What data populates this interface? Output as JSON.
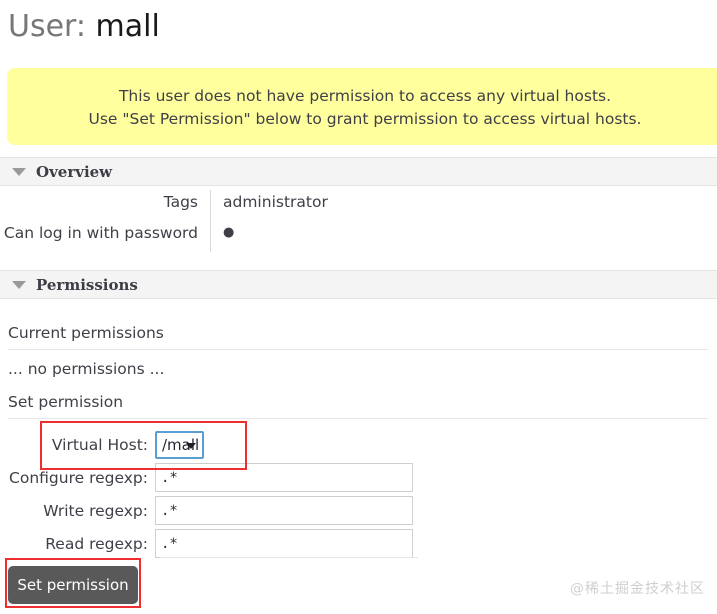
{
  "page": {
    "title_prefix": "User:",
    "title_value": "mall"
  },
  "warning": {
    "line1": "This user does not have permission to access any virtual hosts.",
    "line2": "Use \"Set Permission\" below to grant permission to access virtual hosts.",
    "background_color": "#ffff9d"
  },
  "overview": {
    "header": "Overview",
    "rows": [
      {
        "key": "Tags",
        "value": "administrator"
      },
      {
        "key": "Can log in with password",
        "value": "●"
      }
    ]
  },
  "permissions": {
    "header": "Permissions",
    "current_permissions_label": "Current permissions",
    "no_permissions_text": "... no permissions ...",
    "set_permission_label": "Set permission",
    "form": {
      "vhost": {
        "label": "Virtual Host:",
        "selected": "/mall",
        "options": [
          "/mall"
        ]
      },
      "configure": {
        "label": "Configure regexp:",
        "value": ".*"
      },
      "write": {
        "label": "Write regexp:",
        "value": ".*"
      },
      "read": {
        "label": "Read regexp:",
        "value": ".*"
      }
    },
    "submit_label": "Set permission"
  },
  "annotations": {
    "color": "#ef2f2f",
    "boxes": [
      "virtual-host-field",
      "set-permission-button"
    ]
  },
  "watermark": {
    "text": "@稀土掘金技术社区"
  }
}
